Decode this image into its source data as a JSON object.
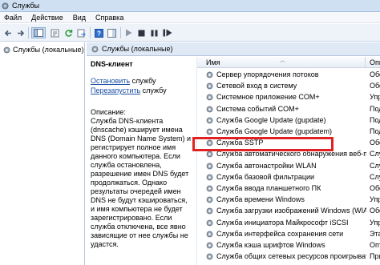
{
  "window": {
    "title": "Службы"
  },
  "menu": [
    "Файл",
    "Действие",
    "Вид",
    "Справка"
  ],
  "tree": {
    "root_label": "Службы (локальные)"
  },
  "right_header": {
    "label": "Службы (локальные)"
  },
  "selected_service": {
    "name": "DNS-клиент",
    "stop_link": "Остановить",
    "stop_suffix": " службу",
    "restart_link": "Перезапустить",
    "restart_suffix": " службу",
    "description_label": "Описание:",
    "description": "Служба DNS-клиента (dnscache) кэширует имена DNS (Domain Name System) и регистрирует полное имя данного компьютера. Если служба остановлена, разрешение имен DNS будет продолжаться. Однако результаты очередей имен DNS не будут кэшироваться, и имя компьютера не будет зарегистрировано. Если служба отключена, все явно зависящие от нее службы не удастся."
  },
  "list": {
    "col_name": "Имя",
    "col_desc": "Опис",
    "rows": [
      {
        "name": "Сервер упорядочения потоков",
        "desc": "Обе"
      },
      {
        "name": "Сетевой вход в систему",
        "desc": "Обе"
      },
      {
        "name": "Системное приложение COM+",
        "desc": "Упр"
      },
      {
        "name": "Система событий COM+",
        "desc": "Под"
      },
      {
        "name": "Служба Google Update (gupdate)",
        "desc": "Под"
      },
      {
        "name": "Служба Google Update (gupdatem)",
        "desc": "Под"
      },
      {
        "name": "Служба SSTP",
        "desc": "Обе"
      },
      {
        "name": "Служба автоматического обнаружения веб-прок…",
        "desc": "Служ"
      },
      {
        "name": "Служба автонастройки WLAN",
        "desc": "Служ"
      },
      {
        "name": "Служба базовой фильтрации",
        "desc": "Служ"
      },
      {
        "name": "Служба ввода планшетного ПК",
        "desc": "Обе"
      },
      {
        "name": "Служба времени Windows",
        "desc": "Упр"
      },
      {
        "name": "Служба загрузки изображений Windows (WIA)",
        "desc": "Обе"
      },
      {
        "name": "Служба инициатора Майкрософт iSCSI",
        "desc": "Упр"
      },
      {
        "name": "Служба интерфейса сохранения сети",
        "desc": "Эта"
      },
      {
        "name": "Служба кэша шрифтов Windows",
        "desc": "Опт"
      },
      {
        "name": "Служба общих сетевых ресурсов проигрывателя Windows Media Center",
        "desc": "При"
      }
    ]
  },
  "colors": {
    "highlight": "#e02222",
    "link": "#1a4ea3",
    "header_bg": "#dfe9f5"
  }
}
